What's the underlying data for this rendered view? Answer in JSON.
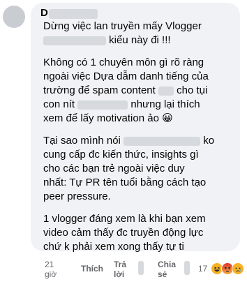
{
  "comment": {
    "author_prefix": "D",
    "lines_para1": [
      "Dừng việc lan truyền mấy Vlogger",
      "kiểu này đi !!!"
    ],
    "para2": [
      "Không có 1 chuyên môn gì rõ ràng",
      "ngoài việc Dựa dẫm danh tiếng của",
      "trường để spam content",
      "cho tụi",
      "con nít",
      "nhưng lại thích",
      "xem để lấy motivation ảo 😀"
    ],
    "para3": [
      "Tại sao mình nói",
      "ko",
      "cung cấp đc kiến thức, insights gì",
      "cho các bạn trẻ ngoài việc duy",
      "nhất: Tự PR tên tuổi bằng cách tạo",
      "peer pressure."
    ],
    "para4": [
      "1 vlogger đáng xem là khi bạn xem",
      "video cảm thấy đc truyền động lực",
      "chứ k phải xem xong thấy tự ti"
    ]
  },
  "actions": {
    "time_line1": "21",
    "time_line2": "giờ",
    "like": "Thích",
    "reply_line1": "Trả",
    "reply_line2": "lời",
    "share_line1": "Chia",
    "share_line2": "sẻ"
  },
  "reactions": {
    "count": "17",
    "icons": [
      "haha-icon",
      "angry-icon",
      "sad-icon"
    ]
  }
}
